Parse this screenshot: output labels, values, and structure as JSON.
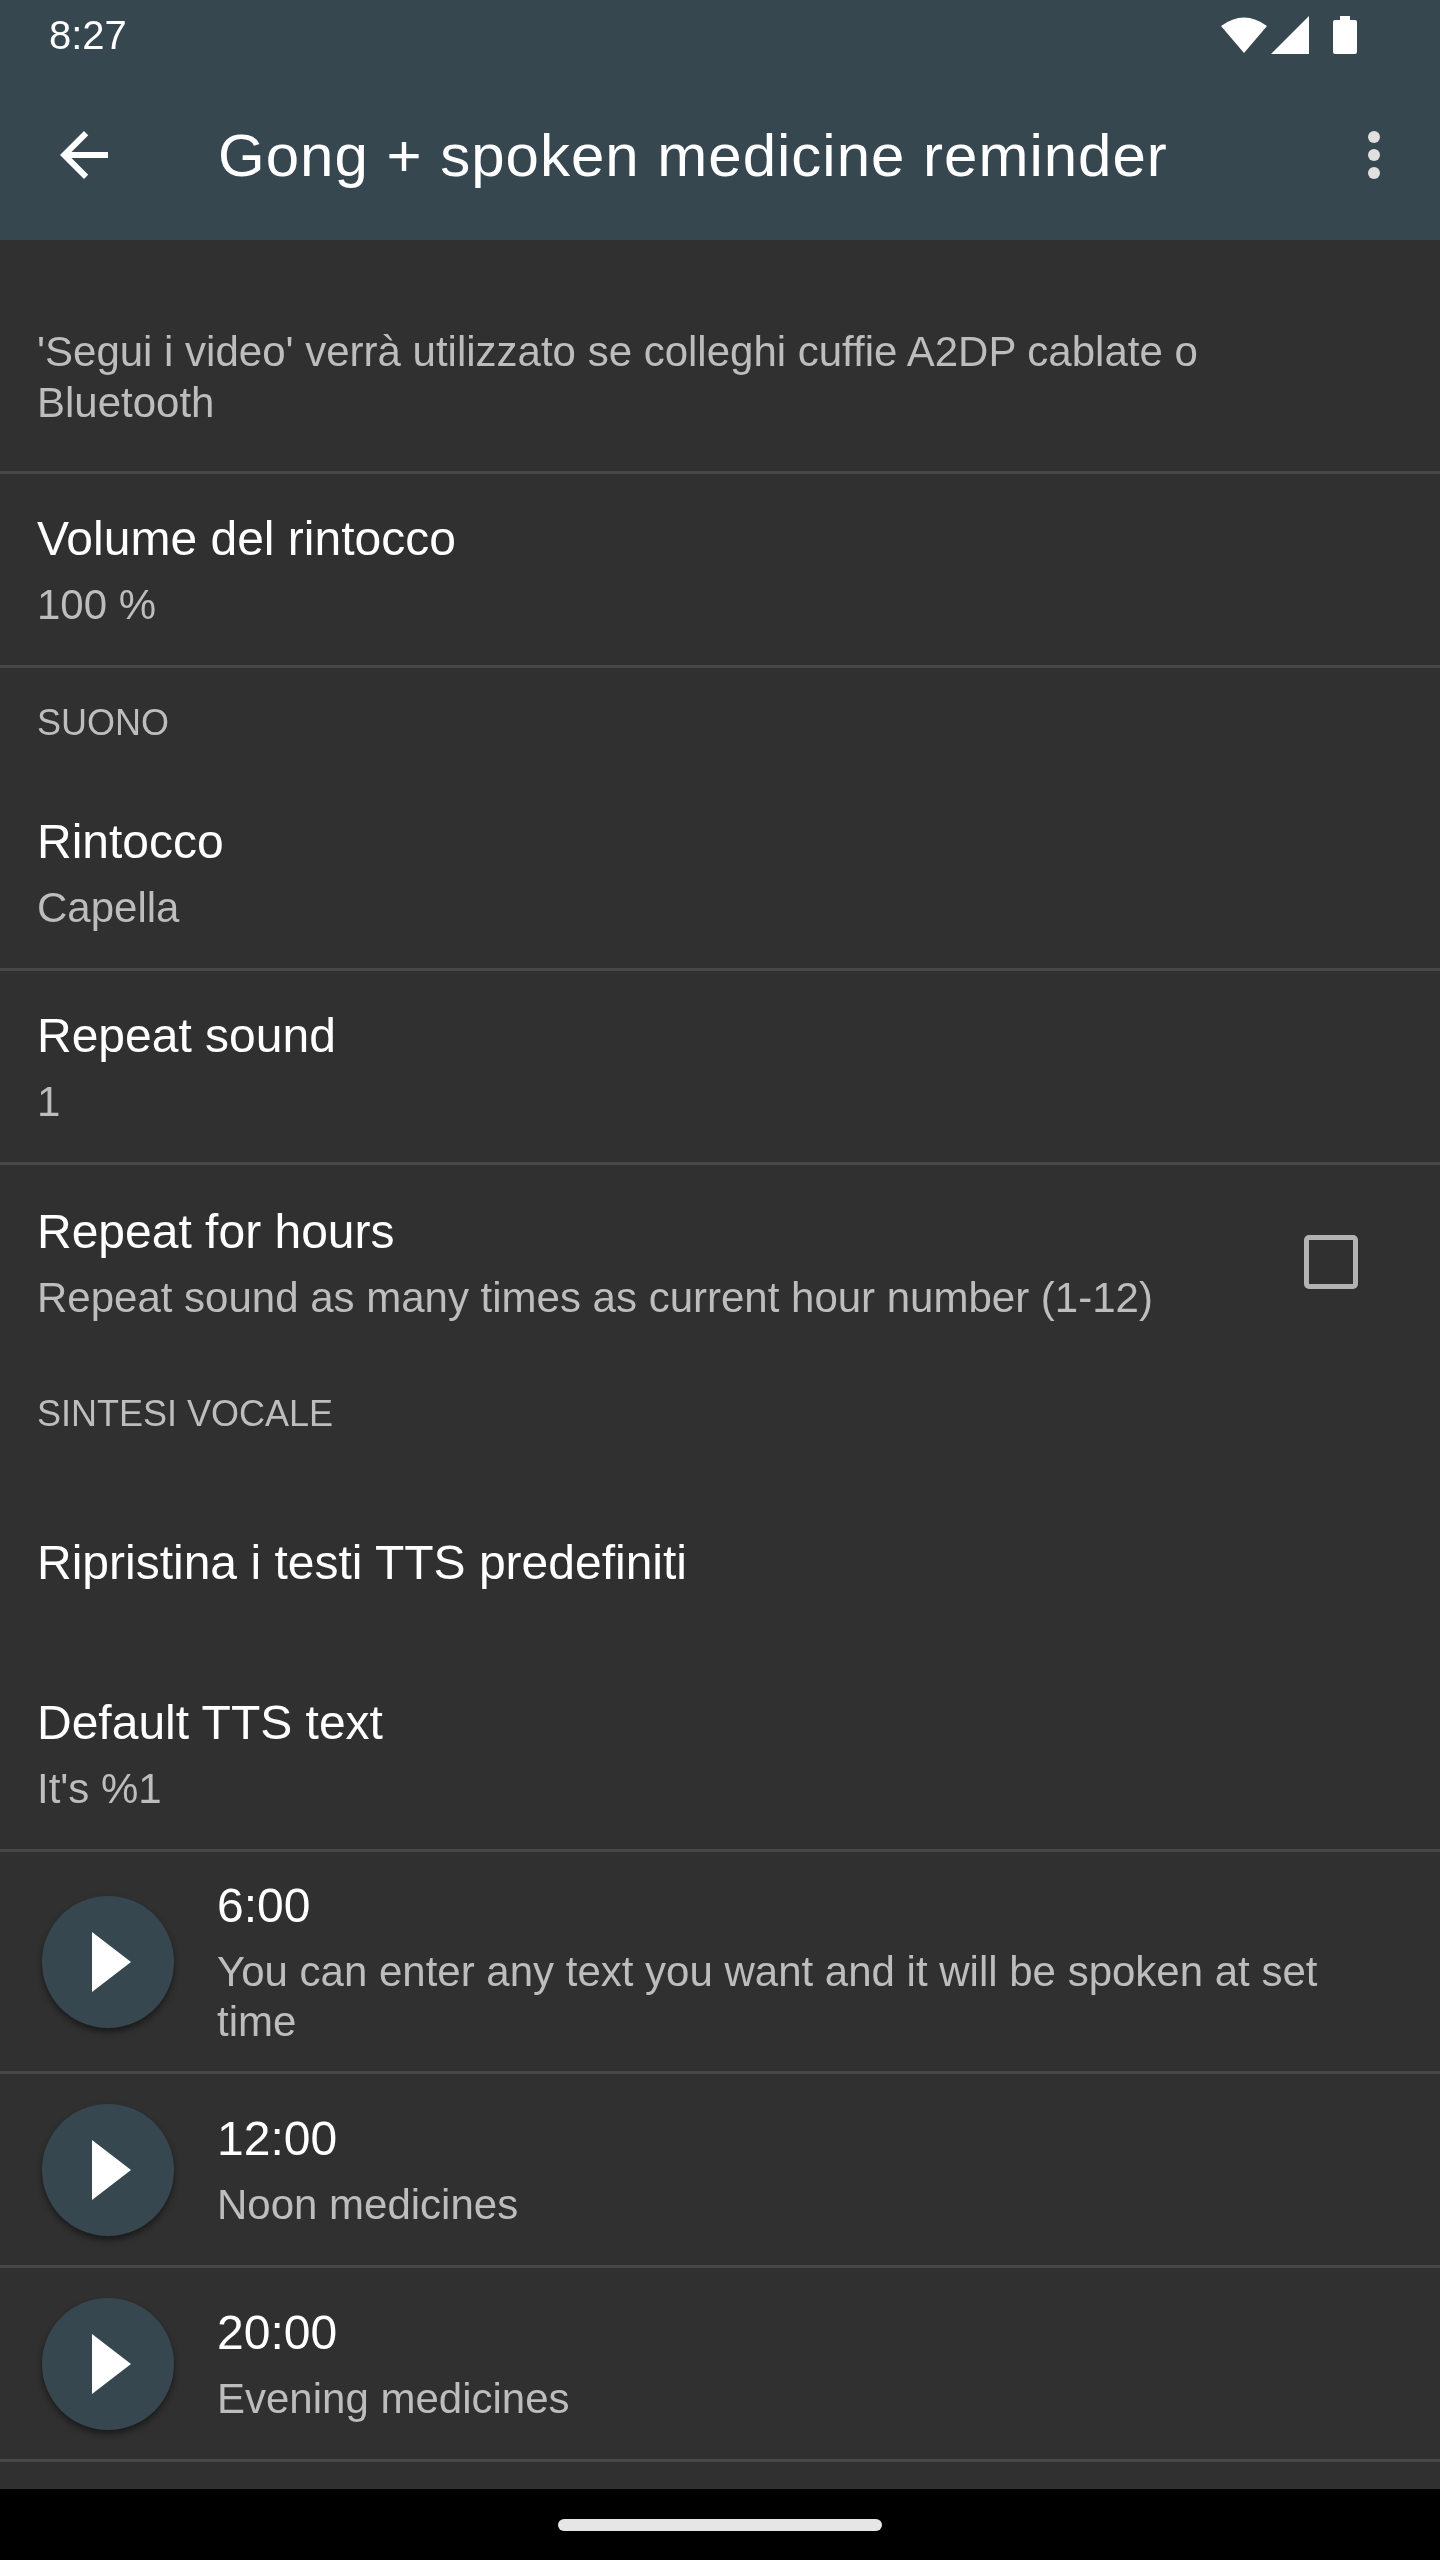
{
  "status_bar": {
    "time": "8:27"
  },
  "app_bar": {
    "title": "Gong + spoken medicine reminder"
  },
  "preferences": [
    {
      "kind": "info",
      "summary": "'Segui i video' verrà utilizzato se colleghi cuffie A2DP cablate o Bluetooth",
      "divider": true
    },
    {
      "kind": "item",
      "title": "Volume del rintocco",
      "summary": "100 %",
      "divider": true
    },
    {
      "kind": "category",
      "title": "SUONO",
      "divider": false
    },
    {
      "kind": "item",
      "title": "Rintocco",
      "summary": "Capella",
      "divider": true
    },
    {
      "kind": "item",
      "title": "Repeat sound",
      "summary": "1",
      "divider": true
    },
    {
      "kind": "checkbox",
      "title": "Repeat for hours",
      "summary": "Repeat sound as many times as current hour number (1-12)",
      "checked": false,
      "divider": false
    },
    {
      "kind": "category",
      "title": "SINTESI VOCALE",
      "divider": false
    },
    {
      "kind": "action",
      "title": "Ripristina i testi TTS predefiniti",
      "divider": false
    },
    {
      "kind": "item",
      "title": "Default TTS text",
      "summary": "It's %1",
      "divider": true
    }
  ],
  "tts_reminders": [
    {
      "time": "6:00",
      "text": "You can enter any text you want and it will be spoken at set time"
    },
    {
      "time": "12:00",
      "text": "Noon medicines"
    },
    {
      "time": "20:00",
      "text": "Evening medicines"
    }
  ]
}
